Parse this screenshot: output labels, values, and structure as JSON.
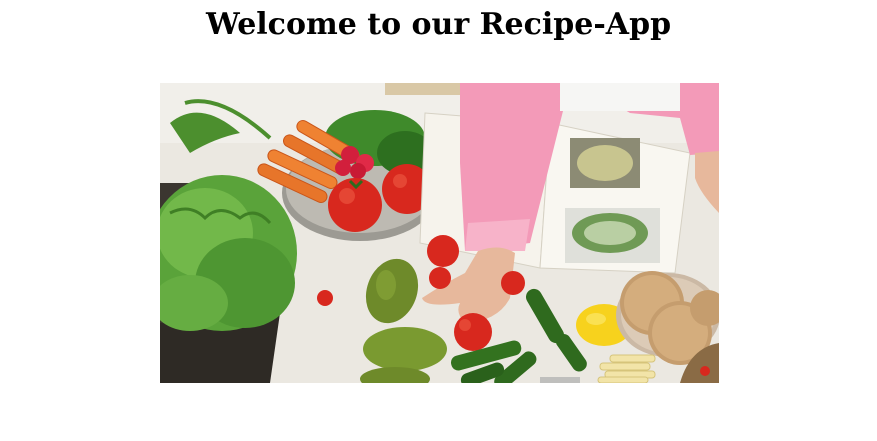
{
  "page": {
    "title": "Welcome to our Recipe-App"
  },
  "hero_image": {
    "subject": "kitchen-counter-with-vegetables-and-recipe-book",
    "colors": {
      "counter": "#ebe8e1",
      "sleeve": "#f39ab8",
      "tomato": "#d8281e",
      "carrot": "#e7752a",
      "lettuce": "#5aa33a",
      "avocado": "#6e8a2a",
      "cucumber": "#2f6a1e",
      "lemon": "#f7d21d",
      "book_page": "#f6f3ec"
    }
  }
}
